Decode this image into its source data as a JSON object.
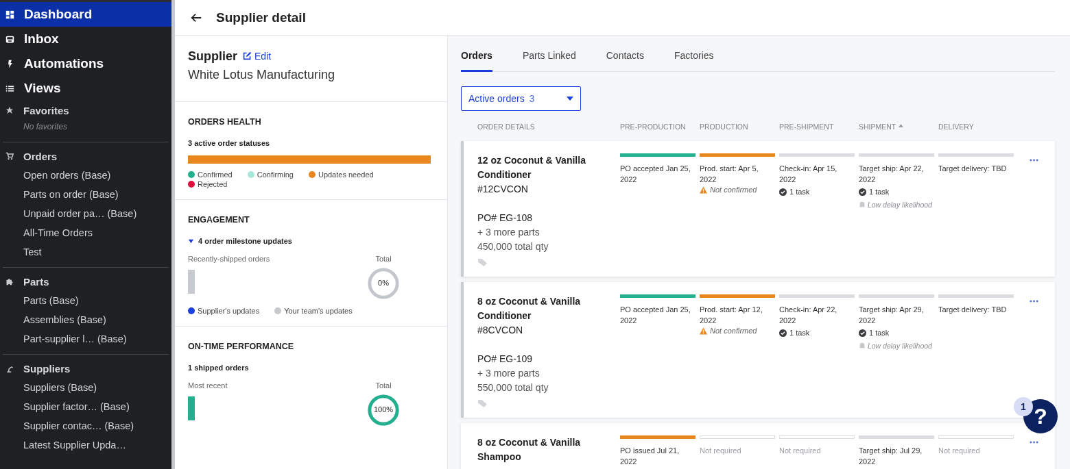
{
  "sidebar": {
    "main_items": [
      {
        "label": "Dashboard",
        "selected": true
      },
      {
        "label": "Inbox",
        "selected": false
      },
      {
        "label": "Automations",
        "selected": false
      },
      {
        "label": "Views",
        "selected": false
      }
    ],
    "sections": [
      {
        "title": "Favorites",
        "empty_note": "No favorites"
      },
      {
        "title": "Orders",
        "items": [
          {
            "label": "Open orders (Base)",
            "selected": false
          },
          {
            "label": "Parts on order (Base)",
            "selected": false
          },
          {
            "label": "Unpaid order pa… (Base)",
            "selected": false
          },
          {
            "label": "All-Time Orders",
            "selected": false
          },
          {
            "label": "Test",
            "selected": false
          }
        ]
      },
      {
        "title": "Parts",
        "items": [
          {
            "label": "Parts (Base)",
            "selected": false
          },
          {
            "label": "Assemblies (Base)",
            "selected": false
          },
          {
            "label": "Part-supplier l… (Base)",
            "selected": false
          }
        ]
      },
      {
        "title": "Suppliers",
        "items": [
          {
            "label": "Suppliers (Base)",
            "selected": false
          },
          {
            "label": "Supplier factor… (Base)",
            "selected": false
          },
          {
            "label": "Supplier contac… (Base)",
            "selected": false
          },
          {
            "label": "Latest Supplier Upda…",
            "selected": false
          }
        ]
      }
    ]
  },
  "header": {
    "title": "Supplier detail"
  },
  "supplier": {
    "label": "Supplier",
    "edit": "Edit",
    "name": "White Lotus Manufacturing"
  },
  "orders_health": {
    "title": "ORDERS HEALTH",
    "subtitle": "3 active order statuses",
    "segments": [
      {
        "color": "#e8871e",
        "level": 1
      }
    ],
    "legend": [
      {
        "label": "Confirmed",
        "color": "#22b08f"
      },
      {
        "label": "Confirming",
        "color": "#a8e6dc"
      },
      {
        "label": "Updates needed",
        "color": "#e8871e"
      },
      {
        "label": "Rejected",
        "color": "#e0103f"
      }
    ]
  },
  "engagement": {
    "title": "ENGAGEMENT",
    "toggle": "4 order milestone updates",
    "expanded": true,
    "left_label": "Recently-shipped orders",
    "total_label": "Total",
    "donut": {
      "label": "0%",
      "level": 0
    },
    "legend": [
      {
        "label": "Supplier's updates",
        "color": "#1a3fdc"
      },
      {
        "label": "Your team's updates",
        "color": "#c6c8cc"
      }
    ]
  },
  "on_time": {
    "title": "ON-TIME PERFORMANCE",
    "subtitle": "1 shipped orders",
    "left_label": "Most recent",
    "total_label": "Total",
    "donut": {
      "label": "100%",
      "level": 1
    }
  },
  "tabs": [
    {
      "label": "Orders",
      "selected": true
    },
    {
      "label": "Parts Linked",
      "selected": false
    },
    {
      "label": "Contacts",
      "selected": false
    },
    {
      "label": "Factories",
      "selected": false
    }
  ],
  "filter": {
    "label": "Active orders",
    "count": "3"
  },
  "columns": [
    {
      "label": "ORDER DETAILS",
      "sorted": false
    },
    {
      "label": "PRE-PRODUCTION",
      "sorted": false
    },
    {
      "label": "PRODUCTION",
      "sorted": false
    },
    {
      "label": "PRE-SHIPMENT",
      "sorted": false
    },
    {
      "label": "SHIPMENT",
      "sorted": true
    },
    {
      "label": "DELIVERY",
      "sorted": false
    }
  ],
  "orders": [
    {
      "title": "12 oz Coconut & Vanilla Conditioner",
      "code": "#12CVCON",
      "po": "PO# EG-108",
      "more_parts": "+ 3 more parts",
      "qty": "450,000 total qty",
      "flagged": true,
      "steps": [
        {
          "kind": "confirmed",
          "text": "PO accepted Jan 25, 2022"
        },
        {
          "kind": "updates_needed",
          "text": "Prod. start: Apr 5, 2022",
          "warning": "Not confirmed"
        },
        {
          "kind": "pending",
          "text": "Check-in: Apr 15, 2022",
          "tasks": "1 task"
        },
        {
          "kind": "pending",
          "text": "Target ship: Apr 22, 2022",
          "tasks": "1 task",
          "alert": "Low delay likelihood"
        },
        {
          "kind": "pending",
          "text": "Target delivery: TBD"
        }
      ]
    },
    {
      "title": "8 oz Coconut & Vanilla Conditioner",
      "code": "#8CVCON",
      "po": "PO# EG-109",
      "more_parts": "+ 3 more parts",
      "qty": "550,000 total qty",
      "flagged": true,
      "steps": [
        {
          "kind": "confirmed",
          "text": "PO accepted Jan 25, 2022"
        },
        {
          "kind": "updates_needed",
          "text": "Prod. start: Apr 12, 2022",
          "warning": "Not confirmed"
        },
        {
          "kind": "pending",
          "text": "Check-in: Apr 22, 2022",
          "tasks": "1 task"
        },
        {
          "kind": "pending",
          "text": "Target ship: Apr 29, 2022",
          "tasks": "1 task",
          "alert": "Low delay likelihood"
        },
        {
          "kind": "pending",
          "text": "Target delivery: TBD"
        }
      ]
    },
    {
      "title": "8 oz Coconut & Vanilla Shampoo",
      "flagged": false,
      "steps": [
        {
          "kind": "updates_needed",
          "text": "PO issued Jul 21, 2022"
        },
        {
          "kind": "not_required",
          "text": "Not required"
        },
        {
          "kind": "not_required",
          "text": "Not required"
        },
        {
          "kind": "pending",
          "text": "Target ship: Jul 29, 2022"
        },
        {
          "kind": "not_required",
          "text": "Not required"
        }
      ]
    }
  ],
  "help": {
    "label": "?",
    "badge": "1"
  }
}
